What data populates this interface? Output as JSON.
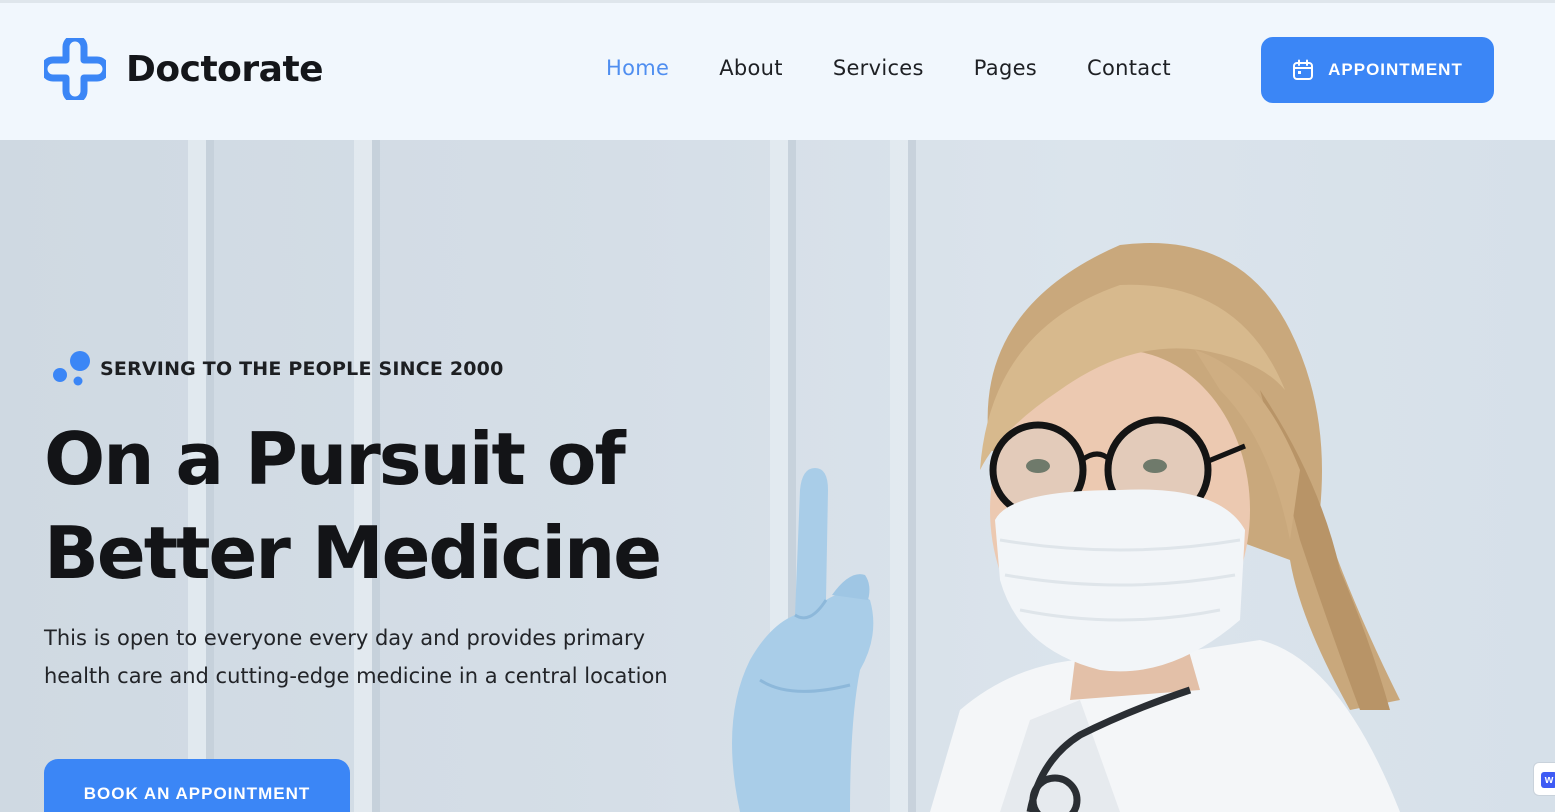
{
  "brand": {
    "name": "Doctorate",
    "accent": "#3b86f6"
  },
  "nav": {
    "items": [
      {
        "label": "Home",
        "active": true
      },
      {
        "label": "About",
        "active": false
      },
      {
        "label": "Services",
        "active": false
      },
      {
        "label": "Pages",
        "active": false
      },
      {
        "label": "Contact",
        "active": false
      }
    ],
    "cta_label": "APPOINTMENT",
    "cta_icon": "calendar-icon"
  },
  "hero": {
    "tagline": "SERVING TO THE PEOPLE SINCE 2000",
    "headline_line1": "On a Pursuit of",
    "headline_line2": "Better Medicine",
    "lead": "This is open to everyone every day and provides primary health care and cutting-edge medicine in a central location",
    "button_label": "BOOK AN APPOINTMENT"
  },
  "widget": {
    "letter": "w"
  }
}
